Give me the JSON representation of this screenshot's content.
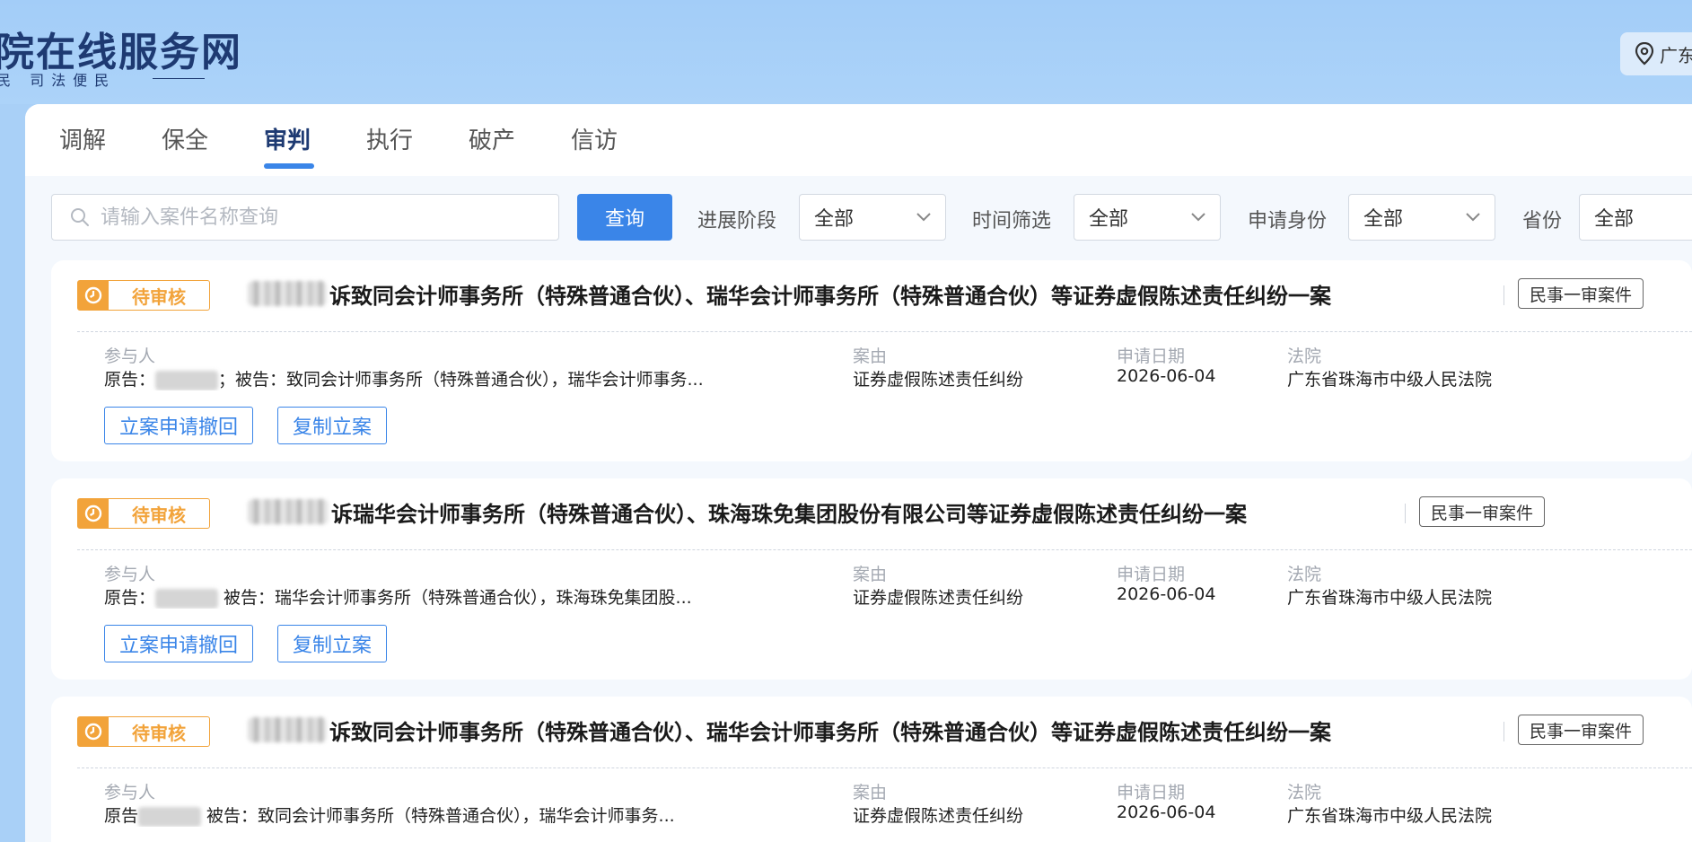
{
  "header": {
    "site_title": "院在线服务网",
    "slogan": "民  司法便民",
    "location": "广东"
  },
  "tabs": [
    {
      "label": "调解"
    },
    {
      "label": "保全"
    },
    {
      "label": "审判"
    },
    {
      "label": "执行"
    },
    {
      "label": "破产"
    },
    {
      "label": "信访"
    }
  ],
  "active_tab": "审判",
  "filters": {
    "search_placeholder": "请输入案件名称查询",
    "query_label": "查询",
    "stage_label": "进展阶段",
    "stage_value": "全部",
    "time_label": "时间筛选",
    "time_value": "全部",
    "identity_label": "申请身份",
    "identity_value": "全部",
    "province_label": "省份",
    "province_value": "全部"
  },
  "field_labels": {
    "party": "参与人",
    "cause": "案由",
    "date": "申请日期",
    "court": "法院"
  },
  "cases": [
    {
      "status": "待审核",
      "title": "诉致同会计师事务所（特殊普通合伙）、瑞华会计师事务所（特殊普通合伙）等证券虚假陈述责任纠纷一案",
      "type": "民事一审案件",
      "plaintiff_prefix": "原告：",
      "defendants": "；被告：致同会计师事务所（特殊普通合伙），瑞华会计师事务...",
      "cause": "证券虚假陈述责任纠纷",
      "date": "2026-06-04",
      "court": "广东省珠海市中级人民法院",
      "withdraw_label": "立案申请撤回",
      "copy_label": "复制立案"
    },
    {
      "status": "待审核",
      "title": "诉瑞华会计师事务所（特殊普通合伙）、珠海珠免集团股份有限公司等证券虚假陈述责任纠纷一案",
      "type": "民事一审案件",
      "plaintiff_prefix": "原告：",
      "defendants": " 被告：瑞华会计师事务所（特殊普通合伙），珠海珠免集团股...",
      "cause": "证券虚假陈述责任纠纷",
      "date": "2026-06-04",
      "court": "广东省珠海市中级人民法院",
      "withdraw_label": "立案申请撤回",
      "copy_label": "复制立案"
    },
    {
      "status": "待审核",
      "title": "诉致同会计师事务所（特殊普通合伙）、瑞华会计师事务所（特殊普通合伙）等证券虚假陈述责任纠纷一案",
      "type": "民事一审案件",
      "plaintiff_prefix": "原告",
      "defendants": " 被告：致同会计师事务所（特殊普通合伙），瑞华会计师事务...",
      "cause": "证券虚假陈述责任纠纷",
      "date": "2026-06-04",
      "court": "广东省珠海市中级人民法院",
      "withdraw_label": "立案申请撤回",
      "copy_label": "复制立案"
    }
  ],
  "colors": {
    "header_bg": "#a9d0f7",
    "accent": "#3a85e8",
    "pending": "#f2a33a",
    "brand_text": "#1e3a72"
  }
}
